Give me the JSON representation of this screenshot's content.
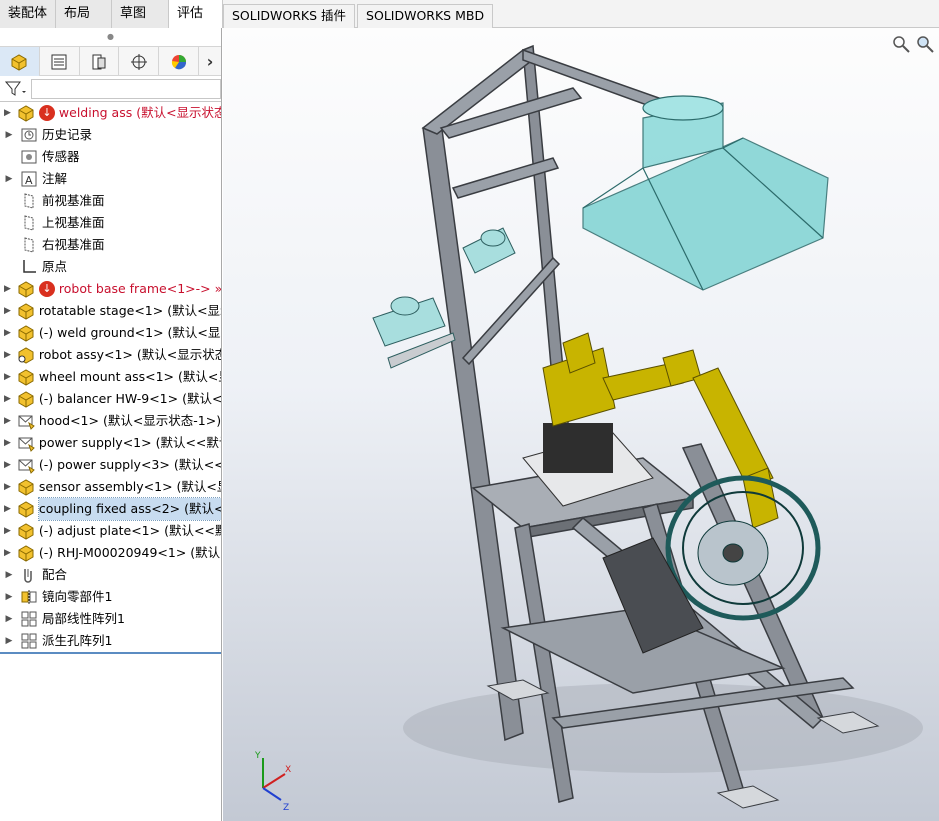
{
  "command_tabs": [
    "装配体",
    "布局",
    "草图",
    "评估"
  ],
  "command_tabs_ext": [
    "SOLIDWORKS 插件",
    "SOLIDWORKS MBD"
  ],
  "manager_tabs": [
    "feature-manager-icon",
    "property-manager-icon",
    "configuration-manager-icon",
    "dimxpert-icon",
    "display-manager-icon"
  ],
  "tree": [
    {
      "label": "welding ass  (默认<显示状态-1",
      "icon": "assembly-icon",
      "error": true,
      "red": true,
      "expand": true,
      "indent": 0
    },
    {
      "label": "历史记录",
      "icon": "history-icon",
      "expand": true,
      "indent": 1
    },
    {
      "label": "传感器",
      "icon": "sensor-icon",
      "expand": false,
      "indent": 1
    },
    {
      "label": "注解",
      "icon": "annotation-icon",
      "expand": true,
      "indent": 1
    },
    {
      "label": "前视基准面",
      "icon": "plane-icon",
      "expand": false,
      "indent": 1
    },
    {
      "label": "上视基准面",
      "icon": "plane-icon",
      "expand": false,
      "indent": 1
    },
    {
      "label": "右视基准面",
      "icon": "plane-icon",
      "expand": false,
      "indent": 1
    },
    {
      "label": "原点",
      "icon": "origin-icon",
      "expand": false,
      "indent": 1
    },
    {
      "label": "robot base frame<1>-> »",
      "icon": "assembly-icon",
      "error": true,
      "red": true,
      "expand": true,
      "indent": 1
    },
    {
      "label": "rotatable stage<1> (默认<显示",
      "icon": "assembly-icon",
      "expand": true,
      "indent": 1
    },
    {
      "label": "(-) weld ground<1> (默认<显示",
      "icon": "assembly-icon",
      "expand": true,
      "indent": 1
    },
    {
      "label": "robot assy<1> (默认<显示状态",
      "icon": "flex-assembly-icon",
      "expand": true,
      "indent": 1
    },
    {
      "label": "wheel mount ass<1> (默认<显",
      "icon": "assembly-icon",
      "expand": true,
      "indent": 1
    },
    {
      "label": "(-) balancer HW-9<1> (默认<",
      "icon": "assembly-icon",
      "expand": true,
      "indent": 1
    },
    {
      "label": "hood<1> (默认<显示状态-1>)",
      "icon": "envelope-icon",
      "expand": true,
      "indent": 1
    },
    {
      "label": "power supply<1> (默认<<默认",
      "icon": "envelope-icon",
      "expand": true,
      "indent": 1
    },
    {
      "label": "(-) power supply<3> (默认<<默",
      "icon": "envelope-icon",
      "expand": true,
      "indent": 1
    },
    {
      "label": "sensor assembly<1> (默认<显",
      "icon": "assembly-icon",
      "expand": true,
      "indent": 1
    },
    {
      "label": "coupling fixed ass<2> (默认<显",
      "icon": "assembly-icon",
      "expand": true,
      "indent": 1,
      "selected": true
    },
    {
      "label": "(-) adjust plate<1> (默认<<默",
      "icon": "assembly-icon",
      "expand": true,
      "indent": 1
    },
    {
      "label": "(-) RHJ-M00020949<1> (默认<",
      "icon": "assembly-icon",
      "expand": true,
      "indent": 1
    },
    {
      "label": "配合",
      "icon": "mates-icon",
      "expand": true,
      "indent": 1
    },
    {
      "label": "镜向零部件1",
      "icon": "mirror-icon",
      "expand": true,
      "indent": 1
    },
    {
      "label": "局部线性阵列1",
      "icon": "pattern-icon",
      "expand": true,
      "indent": 1
    },
    {
      "label": "派生孔阵列1",
      "icon": "pattern-icon",
      "expand": true,
      "indent": 1
    }
  ],
  "view_tools": [
    "zoom-icon",
    "zoom-area-icon"
  ],
  "triad": {
    "x_label": "X",
    "y_label": "Y",
    "z_label": "Z"
  },
  "colors": {
    "selection": "#c8dcf0",
    "error_red": "#c8102e",
    "frame_gray": "#8a8f97",
    "robot_yellow": "#c8b400",
    "hood_cyan": "#7fd3d3"
  }
}
